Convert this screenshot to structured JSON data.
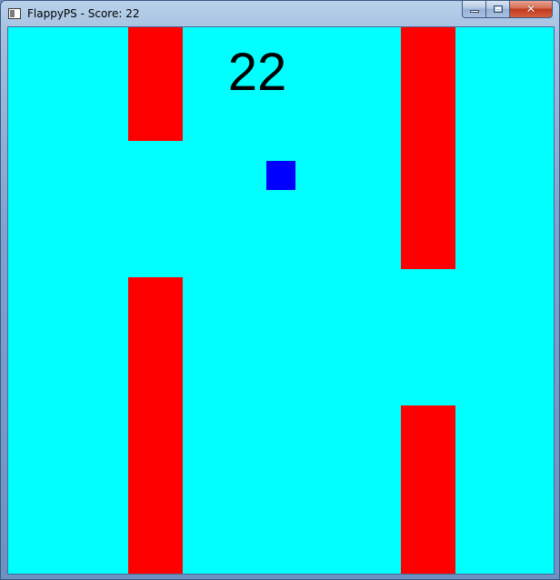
{
  "window": {
    "title": "FlappyPS - Score: 22",
    "app_icon": "window-app-icon",
    "caption_buttons": {
      "minimize_icon": "minimize-icon",
      "maximize_icon": "maximize-icon",
      "close_icon": "close-icon",
      "close_glyph": "✕"
    }
  },
  "game": {
    "score": "22",
    "colors": {
      "background": "#00ffff",
      "pipe": "#ff0000",
      "player": "#0000ff",
      "score_text": "#000000"
    }
  }
}
